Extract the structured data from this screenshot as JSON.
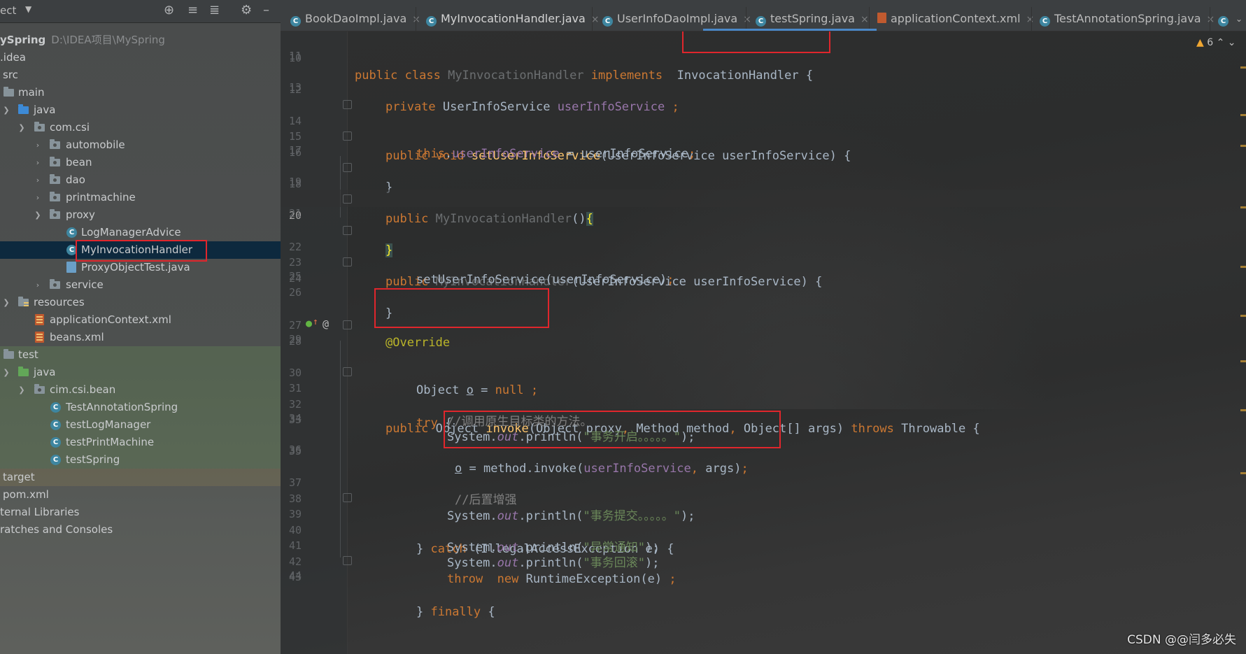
{
  "project_panel": {
    "title": "ect",
    "root_name": "ySpring",
    "root_path": "D:\\IDEA项目\\MySpring",
    "items": [
      {
        "label": "idea",
        "prefix": "."
      },
      {
        "label": "src"
      },
      {
        "label": "main"
      },
      {
        "label": "java"
      },
      {
        "label": "com.csi"
      },
      {
        "label": "automobile"
      },
      {
        "label": "bean"
      },
      {
        "label": "dao"
      },
      {
        "label": "printmachine"
      },
      {
        "label": "proxy"
      },
      {
        "label": "LogManagerAdvice"
      },
      {
        "label": "MyInvocationHandler"
      },
      {
        "label": "ProxyObjectTest.java"
      },
      {
        "label": "service"
      },
      {
        "label": "resources"
      },
      {
        "label": "applicationContext.xml"
      },
      {
        "label": "beans.xml"
      },
      {
        "label": "test"
      },
      {
        "label": "java"
      },
      {
        "label": "cim.csi.bean"
      },
      {
        "label": "TestAnnotationSpring"
      },
      {
        "label": "testLogManager"
      },
      {
        "label": "testPrintMachine"
      },
      {
        "label": "testSpring"
      },
      {
        "label": "target"
      },
      {
        "label": "pom.xml"
      },
      {
        "label": "ternal Libraries"
      },
      {
        "label": "ratches and Consoles"
      }
    ]
  },
  "tabs": [
    {
      "label": "BookDaoImpl.java",
      "icon": "class-icon"
    },
    {
      "label": "MyInvocationHandler.java",
      "icon": "class-icon"
    },
    {
      "label": "UserInfoDaoImpl.java",
      "icon": "class-icon"
    },
    {
      "label": "testSpring.java",
      "icon": "class-icon"
    },
    {
      "label": "applicationContext.xml",
      "icon": "xml-icon"
    },
    {
      "label": "TestAnnotationSpring.java",
      "icon": "class-icon"
    }
  ],
  "editor": {
    "warning_count": "6",
    "current_line": "20",
    "line_numbers": [
      "10",
      "11",
      "12",
      "13",
      "14",
      "15",
      "16",
      "17",
      "18",
      "19",
      "20",
      "21",
      "22",
      "23",
      "24",
      "25",
      "26",
      "27",
      "28",
      "29",
      "30",
      "31",
      "32",
      "33",
      "34",
      "35",
      "36",
      "37",
      "38",
      "39",
      "40",
      "41",
      "42",
      "43",
      "44"
    ],
    "code": {
      "l10_kw": "public class",
      "l10_name": "MyInvocationHandler",
      "l10_impl": "implements",
      "l10_iface": "InvocationHandler",
      "l10_brace": "{",
      "l12_kw": "private",
      "l12_type": "UserInfoService",
      "l12_field": "userInfoService",
      "l12_semi": ";",
      "l14_kw": "public void",
      "l14_fn": "setUserInfoService",
      "l14_params": "(UserInfoService userInfoService) {",
      "l15_this": "this",
      "l15_field": "userInfoService",
      "l15_rest": " = userInfoService",
      "l15_semi": ";",
      "l16": "}",
      "l18_kw": "public",
      "l18_name": "MyInvocationHandler",
      "l18_paren": "()",
      "l18_brace": "{",
      "l20_brace": "}",
      "l22_kw": "public",
      "l22_name": "MyInvocationHandler",
      "l22_params": "(UserInfoService userInfoService) {",
      "l23_call": "setUserInfoService(userInfoService)",
      "l23_semi": ";",
      "l24": "}",
      "l27_ann": "@Override",
      "l28_kw": "public",
      "l28_type": "Object",
      "l28_fn": "invoke",
      "l28_params_a": "(Object proxy",
      "l28_params_b": "Method method",
      "l28_params_c": "Object[] args)",
      "l28_throws": "throws",
      "l28_rest": "Throwable {",
      "l30_type": "Object",
      "l30_var": "o",
      "l30_eq": " = ",
      "l30_null": "null",
      "l30_semi": ";",
      "l31_try": "try",
      "l31_brace": "{",
      "l32_comment": "//调用原生目标类的方法。",
      "l33_sys": "System.",
      "l33_out": "out",
      "l33_call": ".println(",
      "l33_str": "\"事务开启。。。。。\"",
      "l33_end": ");",
      "l35_var": "o",
      "l35_call": " = method.invoke(",
      "l35_field": "userInfoService",
      "l35_args": "args)",
      "l35_semi": ";",
      "l37_comment": "//后置增强",
      "l38_sys": "System.",
      "l38_out": "out",
      "l38_call": ".println(",
      "l38_str": "\"事务提交。。。。。\"",
      "l38_end": ");",
      "l39_close": "} ",
      "l39_catch": "catch",
      "l39_rest": " (IllegalAccessException e) {",
      "l40_sys": "System.",
      "l40_out": "out",
      "l40_call": ".println(",
      "l40_str": "\"异常通知\"",
      "l40_end": ");",
      "l41_sys": "System.",
      "l41_out": "out",
      "l41_call": ".println(",
      "l41_str": "\"事务回滚\"",
      "l41_end": ");",
      "l42_throw": "throw",
      "l42_new": "new",
      "l42_rest": " RuntimeException(e)",
      "l42_semi": ";",
      "l43_close": "} ",
      "l43_finally": "finally",
      "l43_brace": " {"
    }
  },
  "watermark": "CSDN @@闫多必失",
  "colors": {
    "keyword": "#cc7832",
    "function": "#ffc66d",
    "field": "#9876aa",
    "string": "#6a8759",
    "comment": "#808080",
    "annotation": "#bbb529",
    "highlight_box": "#e0262c",
    "selection": "#0d293e"
  }
}
